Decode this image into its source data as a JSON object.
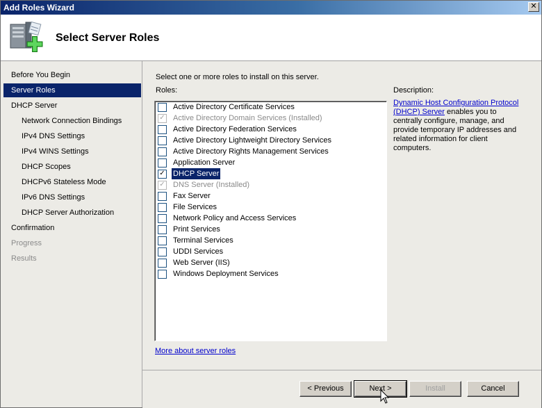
{
  "window": {
    "title": "Add Roles Wizard",
    "close_glyph": "✕"
  },
  "header": {
    "title": "Select Server Roles",
    "icon": "server-roles-icon"
  },
  "nav": {
    "items": [
      {
        "label": "Before You Begin",
        "level": 0,
        "state": "normal"
      },
      {
        "label": "Server Roles",
        "level": 0,
        "state": "selected"
      },
      {
        "label": "DHCP Server",
        "level": 0,
        "state": "normal"
      },
      {
        "label": "Network Connection Bindings",
        "level": 1,
        "state": "normal"
      },
      {
        "label": "IPv4 DNS Settings",
        "level": 1,
        "state": "normal"
      },
      {
        "label": "IPv4 WINS Settings",
        "level": 1,
        "state": "normal"
      },
      {
        "label": "DHCP Scopes",
        "level": 1,
        "state": "normal"
      },
      {
        "label": "DHCPv6 Stateless Mode",
        "level": 1,
        "state": "normal"
      },
      {
        "label": "IPv6 DNS Settings",
        "level": 1,
        "state": "normal"
      },
      {
        "label": "DHCP Server Authorization",
        "level": 1,
        "state": "normal"
      },
      {
        "label": "Confirmation",
        "level": 0,
        "state": "normal"
      },
      {
        "label": "Progress",
        "level": 0,
        "state": "disabled"
      },
      {
        "label": "Results",
        "level": 0,
        "state": "disabled"
      }
    ]
  },
  "content": {
    "instruction": "Select one or more roles to install on this server.",
    "roles_label": "Roles:",
    "roles": [
      {
        "label": "Active Directory Certificate Services",
        "checked": false,
        "disabled": false
      },
      {
        "label": "Active Directory Domain Services  (Installed)",
        "checked": true,
        "disabled": true
      },
      {
        "label": "Active Directory Federation Services",
        "checked": false,
        "disabled": false
      },
      {
        "label": "Active Directory Lightweight Directory Services",
        "checked": false,
        "disabled": false
      },
      {
        "label": "Active Directory Rights Management Services",
        "checked": false,
        "disabled": false
      },
      {
        "label": "Application Server",
        "checked": false,
        "disabled": false
      },
      {
        "label": "DHCP Server",
        "checked": true,
        "disabled": false,
        "selected": true
      },
      {
        "label": "DNS Server  (Installed)",
        "checked": true,
        "disabled": true
      },
      {
        "label": "Fax Server",
        "checked": false,
        "disabled": false
      },
      {
        "label": "File Services",
        "checked": false,
        "disabled": false
      },
      {
        "label": "Network Policy and Access Services",
        "checked": false,
        "disabled": false
      },
      {
        "label": "Print Services",
        "checked": false,
        "disabled": false
      },
      {
        "label": "Terminal Services",
        "checked": false,
        "disabled": false
      },
      {
        "label": "UDDI Services",
        "checked": false,
        "disabled": false
      },
      {
        "label": "Web Server (IIS)",
        "checked": false,
        "disabled": false
      },
      {
        "label": "Windows Deployment Services",
        "checked": false,
        "disabled": false
      }
    ],
    "description_label": "Description:",
    "description_link": "Dynamic Host Configuration Protocol (DHCP) Server",
    "description_text": " enables you to centrally configure, manage, and provide temporary IP addresses and related information for client computers.",
    "more_link": "More about server roles"
  },
  "footer": {
    "previous": "< Previous",
    "next": "Next >",
    "install": "Install",
    "cancel": "Cancel"
  },
  "colors": {
    "title_bar": "#0a246a",
    "selection": "#0a246a",
    "link": "#0000cc",
    "nav_background": "#ecebe6"
  }
}
